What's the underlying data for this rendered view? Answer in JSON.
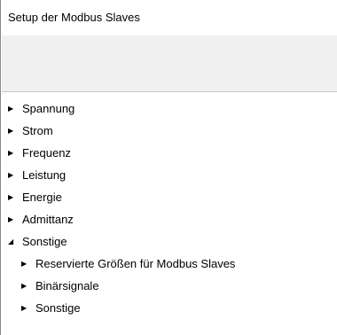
{
  "window": {
    "title": "Setup der Modbus Slaves"
  },
  "tree": {
    "items": [
      {
        "label": "Spannung",
        "expanded": false,
        "icon": "collapsed-arrow-icon"
      },
      {
        "label": "Strom",
        "expanded": false,
        "icon": "collapsed-arrow-icon"
      },
      {
        "label": "Frequenz",
        "expanded": false,
        "icon": "collapsed-arrow-icon"
      },
      {
        "label": "Leistung",
        "expanded": false,
        "icon": "collapsed-arrow-icon"
      },
      {
        "label": "Energie",
        "expanded": false,
        "icon": "collapsed-arrow-icon"
      },
      {
        "label": "Admittanz",
        "expanded": false,
        "icon": "collapsed-arrow-icon"
      },
      {
        "label": "Sonstige",
        "expanded": true,
        "icon": "expanded-arrow-icon",
        "children": [
          {
            "label": "Reservierte Größen für Modbus Slaves",
            "expanded": false,
            "icon": "collapsed-arrow-icon"
          },
          {
            "label": "Binärsignale",
            "expanded": false,
            "icon": "collapsed-arrow-icon"
          },
          {
            "label": "Sonstige",
            "expanded": false,
            "icon": "collapsed-arrow-icon"
          }
        ]
      }
    ]
  },
  "colors": {
    "background": "#ffffff",
    "toolbar": "#f0f0f0",
    "border": "#8a8a8a"
  }
}
